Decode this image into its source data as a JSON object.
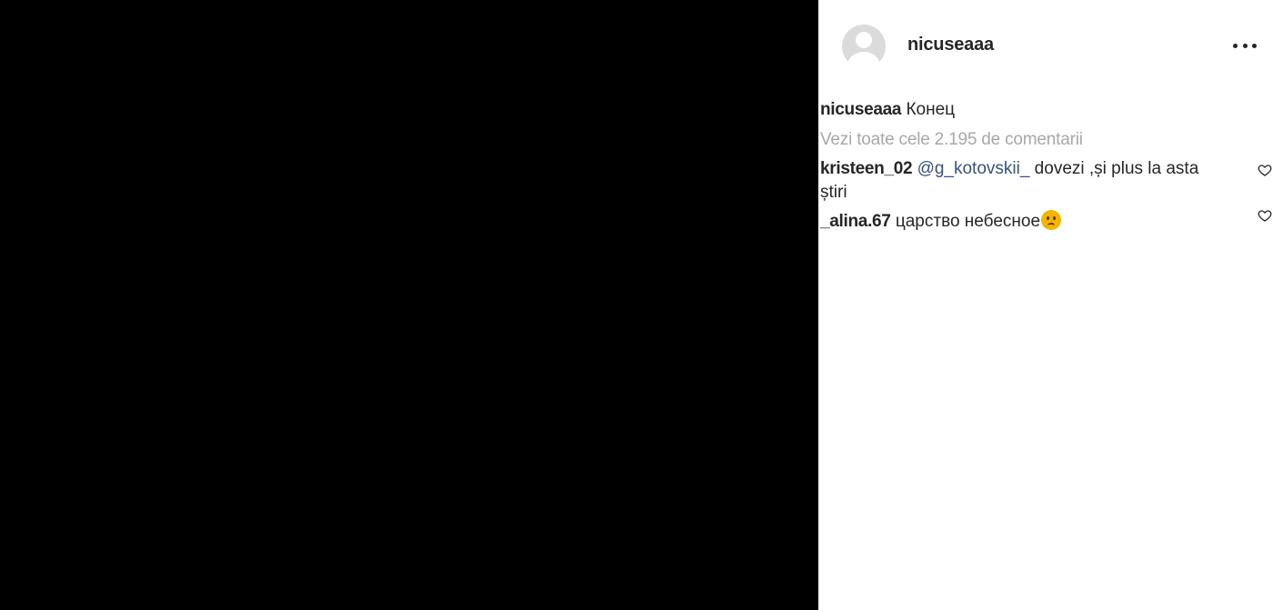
{
  "post": {
    "username": "nicuseaaa",
    "more_icon": "more-horizontal-icon"
  },
  "caption": {
    "username": "nicuseaaa",
    "text": "Конец"
  },
  "view_all_comments": "Vezi toate cele 2.195 de comentarii",
  "comments": [
    {
      "username": "kristeen_02",
      "mention": "@g_kotovskii_",
      "text": " dovezi ,și plus la asta știri",
      "like_icon": "heart-icon"
    },
    {
      "username": "_alina.67",
      "text": "царство небесное",
      "emoji": "sad-face-emoji",
      "like_icon": "heart-icon"
    }
  ],
  "colors": {
    "media_background": "#000000",
    "mention": "#385185",
    "muted_text": "#a8a8a8",
    "avatar_placeholder": "#dbdbdb"
  }
}
